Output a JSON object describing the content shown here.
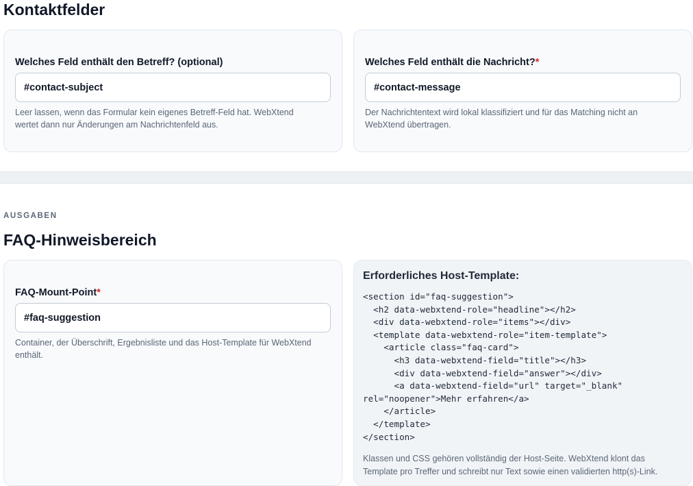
{
  "section_contact": {
    "title": "Kontaktfelder",
    "subject_field": {
      "label": "Welches Feld enthält den Betreff? (optional)",
      "value": "#contact-subject",
      "help_line1": "Leer lassen, wenn das Formular kein eigenes Betreff-Feld hat. WebXtend",
      "help_line2": "wertet dann nur Änderungen am Nachrichtenfeld aus."
    },
    "message_field": {
      "label": "Welches Feld enthält die Nachricht?",
      "required_mark": "*",
      "value": "#contact-message",
      "help_line1": "Der Nachrichtentext wird lokal klassifiziert und für das Matching nicht an",
      "help_line2": "WebXtend übertragen."
    }
  },
  "section_outputs": {
    "kicker": "AUSGABEN",
    "title": "FAQ-Hinweisbereich",
    "mount_field": {
      "label": "FAQ-Mount-Point",
      "required_mark": "*",
      "value": "#faq-suggestion",
      "help_line1": "Container, der Überschrift, Ergebnisliste und das Host-Template für WebXtend",
      "help_line2": "enthält."
    },
    "template_panel": {
      "title": "Erforderliches Host-Template:",
      "code": "<section id=\"faq-suggestion\">\n  <h2 data-webxtend-role=\"headline\"></h2>\n  <div data-webxtend-role=\"items\"></div>\n  <template data-webxtend-role=\"item-template\">\n    <article class=\"faq-card\">\n      <h3 data-webxtend-field=\"title\"></h3>\n      <div data-webxtend-field=\"answer\"></div>\n      <a data-webxtend-field=\"url\" target=\"_blank\"\nrel=\"noopener\">Mehr erfahren</a>\n    </article>\n  </template>\n</section>",
      "note_line1": "Klassen und CSS gehören vollständig der Host-Seite. WebXtend klont das",
      "note_line2": "Template pro Treffer und schreibt nur Text sowie einen validierten http(s)-Link."
    }
  }
}
